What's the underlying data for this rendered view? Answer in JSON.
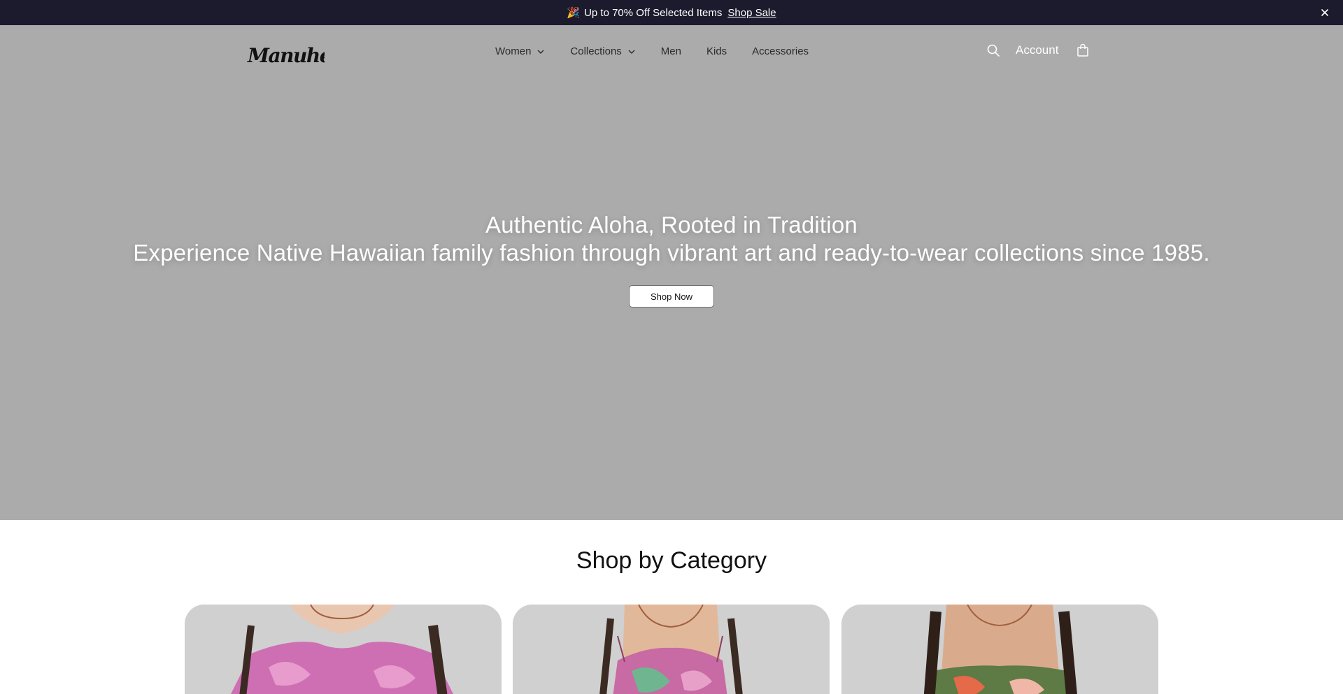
{
  "announcement": {
    "emoji": "🎉",
    "text": "Up to 70% Off Selected Items",
    "link_label": "Shop Sale"
  },
  "header": {
    "logo_text": "Manuheali'i",
    "nav": [
      {
        "label": "Women",
        "has_dropdown": true
      },
      {
        "label": "Collections",
        "has_dropdown": true
      },
      {
        "label": "Men",
        "has_dropdown": false
      },
      {
        "label": "Kids",
        "has_dropdown": false
      },
      {
        "label": "Accessories",
        "has_dropdown": false
      }
    ],
    "account_label": "Account",
    "icons": [
      "search-icon",
      "bag-icon",
      "close-icon",
      "chevron-down-icon"
    ]
  },
  "hero": {
    "title": "Authentic Aloha, Rooted in Tradition",
    "subtitle": "Experience Native Hawaiian family fashion through vibrant art and ready-to-wear collections since 1985.",
    "cta_label": "Shop Now",
    "background_color": "#ababab"
  },
  "categories": {
    "heading": "Shop by Category"
  },
  "colors": {
    "announcement_bg": "#1c1b2e",
    "card_bg": "#d0d0d0"
  }
}
